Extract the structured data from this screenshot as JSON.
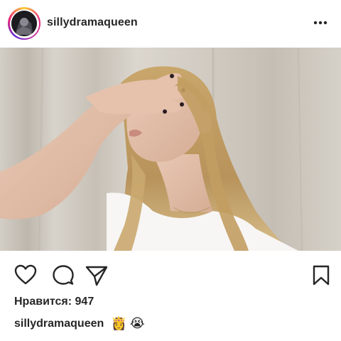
{
  "post": {
    "username": "sillydramaqueen",
    "likes_text": "Нравится: 947",
    "caption": {
      "username": "sillydramaqueen",
      "emojis": [
        "👸",
        "😭"
      ]
    }
  },
  "icons": {
    "more": "more-options-icon",
    "like": "heart-icon",
    "comment": "comment-icon",
    "share": "paper-plane-icon",
    "save": "bookmark-icon"
  },
  "colors": {
    "text": "#262626",
    "ring_start": "#f9ce34",
    "ring_end": "#6228d7"
  }
}
